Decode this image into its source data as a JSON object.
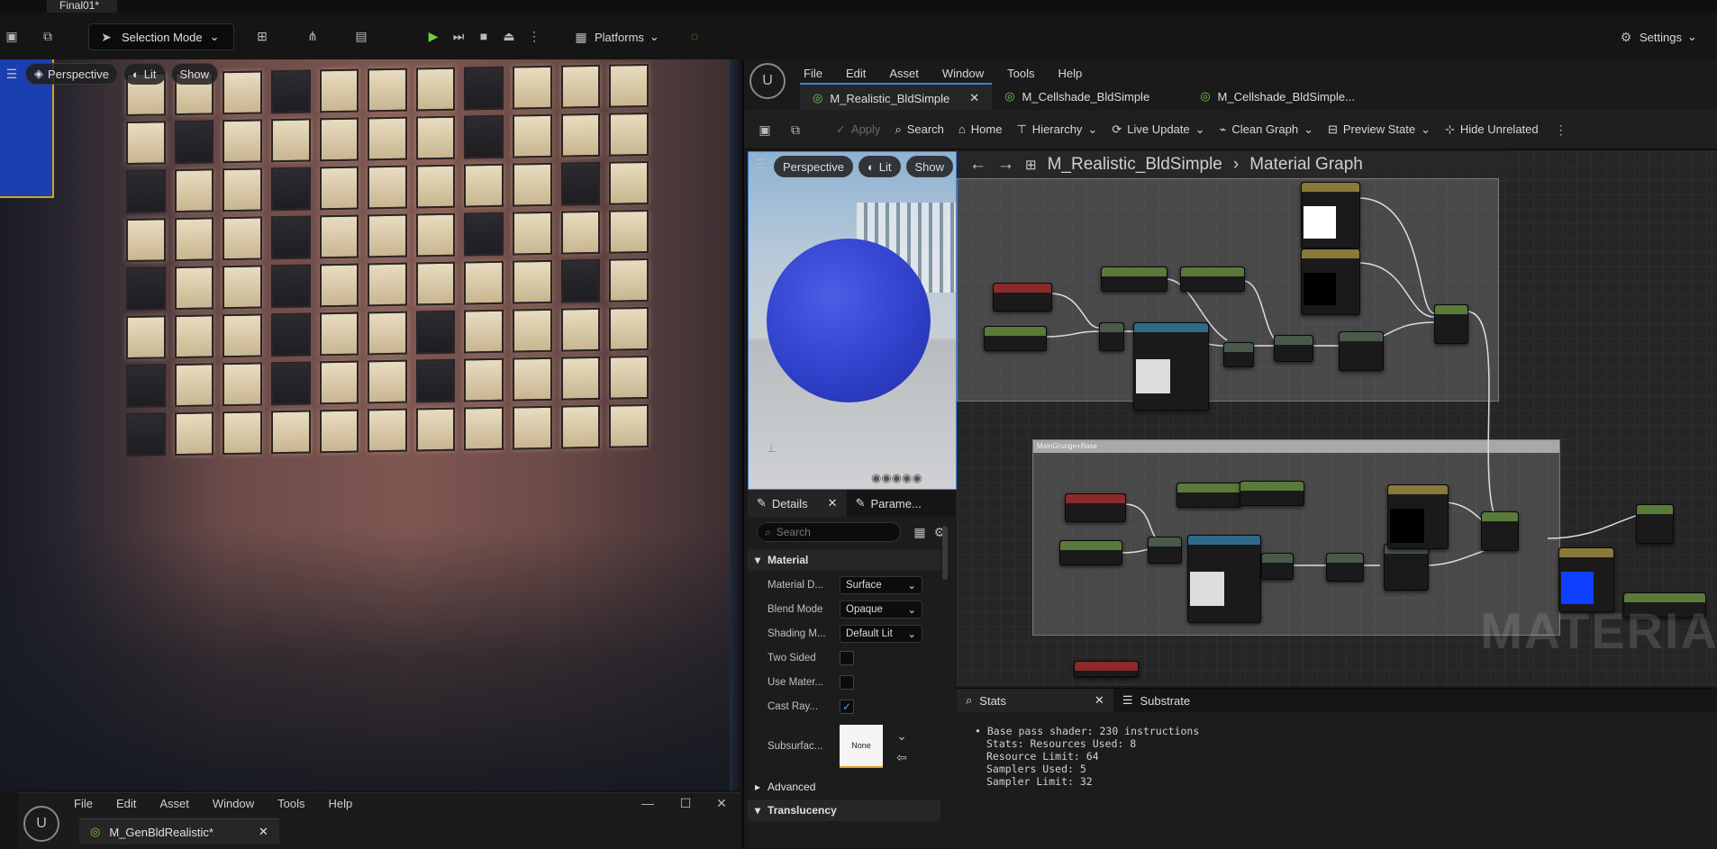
{
  "app": {
    "title": "Final01*"
  },
  "toolbar": {
    "selection_mode": "Selection Mode",
    "platforms": "Platforms",
    "settings": "Settings"
  },
  "viewport": {
    "perspective": "Perspective",
    "lit": "Lit",
    "show": "Show"
  },
  "bottom_window": {
    "menu": [
      "File",
      "Edit",
      "Asset",
      "Window",
      "Tools",
      "Help"
    ],
    "tab": "M_GenBldRealistic*"
  },
  "material_editor": {
    "menu": [
      "File",
      "Edit",
      "Asset",
      "Window",
      "Tools",
      "Help"
    ],
    "tabs": [
      "M_Realistic_BldSimple",
      "M_Cellshade_BldSimple",
      "M_Cellshade_BldSimple..."
    ],
    "toolbar": {
      "apply": "Apply",
      "search": "Search",
      "home": "Home",
      "hierarchy": "Hierarchy",
      "live_update": "Live Update",
      "clean_graph": "Clean Graph",
      "preview_state": "Preview State",
      "hide_unrelated": "Hide Unrelated"
    },
    "preview": {
      "perspective": "Perspective",
      "lit": "Lit",
      "show": "Show"
    },
    "breadcrumb": {
      "asset": "M_Realistic_BldSimple",
      "graph": "Material Graph"
    },
    "graph_comment": "MainGrunge+Base",
    "watermark": "MATERIA"
  },
  "details": {
    "tabs": [
      "Details",
      "Parame..."
    ],
    "search_placeholder": "Search",
    "sections": {
      "material": "Material",
      "advanced": "Advanced",
      "translucency": "Translucency"
    },
    "properties": [
      {
        "label": "Material D...",
        "value": "Surface"
      },
      {
        "label": "Blend Mode",
        "value": "Opaque"
      },
      {
        "label": "Shading M...",
        "value": "Default Lit"
      }
    ],
    "checks": [
      {
        "label": "Two Sided",
        "checked": false
      },
      {
        "label": "Use Mater...",
        "checked": false
      },
      {
        "label": "Cast Ray...",
        "checked": true
      }
    ],
    "subsurface": {
      "label": "Subsurfac...",
      "value": "None"
    }
  },
  "stats": {
    "tabs": [
      "Stats",
      "Substrate"
    ],
    "lines": [
      "Base pass shader: 230 instructions",
      "Stats: Resources Used: 8",
      "Resource Limit: 64",
      "Samplers Used: 5",
      "Sampler Limit: 32"
    ]
  },
  "colors": {
    "accent": "#3a7fe0",
    "play": "#6fcf3f",
    "sphere": "#2e3fc8"
  }
}
